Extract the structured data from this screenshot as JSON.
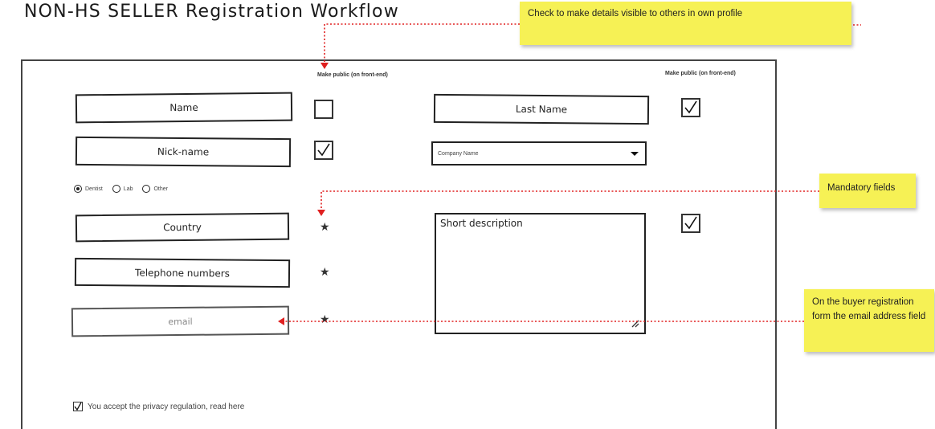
{
  "title": "NON-HS SELLER Registration Workflow",
  "form": {
    "public_header_left": "Make public (on front-end)",
    "public_header_right": "Make public (on front-end)",
    "name": "Name",
    "last_name": "Last Name",
    "nickname": "Nick-name",
    "company_select": {
      "selected": "Company Name"
    },
    "role_options": [
      {
        "label": "Dentist",
        "selected": true
      },
      {
        "label": "Lab",
        "selected": false
      },
      {
        "label": "Other",
        "selected": false
      }
    ],
    "country": "Country",
    "telephone": "Telephone numbers",
    "email_placeholder": "email",
    "short_description": "Short description",
    "mandatory_marker": "★",
    "privacy": "You accept the privacy regulation, read here",
    "checkboxes": {
      "name_public": false,
      "last_name_public": true,
      "nickname_public": true,
      "description_public": true,
      "privacy_accepted": true
    }
  },
  "notes": {
    "make_public": "Check to make details visible to others in own profile",
    "mandatory": "Mandatory fields",
    "email": "On the buyer registration form the email address field"
  },
  "colors": {
    "note_bg": "#f6f155",
    "arrow": "#e02020",
    "ink": "#222222"
  }
}
